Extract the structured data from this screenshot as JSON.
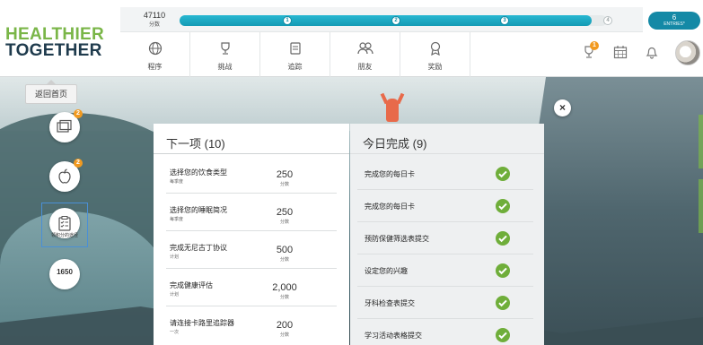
{
  "brand": {
    "line1": "HEALTHIER",
    "line2": "TOGETHER"
  },
  "progress": {
    "points_value": "47110",
    "points_label": "分数",
    "fill_fraction": 0.964,
    "milestones": [
      "1",
      "2",
      "3",
      "4"
    ],
    "entries_count": "6",
    "entries_label": "ENTRIES*"
  },
  "nav": [
    {
      "label": "程序",
      "icon": "globe-icon"
    },
    {
      "label": "挑战",
      "icon": "trophy-icon"
    },
    {
      "label": "追踪",
      "icon": "tracker-icon"
    },
    {
      "label": "朋友",
      "icon": "friends-icon"
    },
    {
      "label": "奖励",
      "icon": "reward-icon"
    }
  ],
  "header_icons": {
    "trophy_badge": "1",
    "calendar": "calendar-icon",
    "bell": "bell-icon"
  },
  "back_home": "返回首页",
  "side": {
    "cards_badge": "2",
    "food_badge": "2",
    "selected_label": "领积分的途径",
    "points": "1650"
  },
  "next_panel": {
    "title": "下一项 (10)",
    "items": [
      {
        "title": "选择您的饮食类型",
        "sub": "每季度",
        "points": "250",
        "points_label": "分数"
      },
      {
        "title": "选择您的睡眠简况",
        "sub": "每季度",
        "points": "250",
        "points_label": "分数"
      },
      {
        "title": "完成无尼古丁协议",
        "sub": "计划",
        "points": "500",
        "points_label": "分数"
      },
      {
        "title": "完成健康评估",
        "sub": "计划",
        "points": "2,000",
        "points_label": "分数"
      },
      {
        "title": "请连接卡路里追踪器",
        "sub": "一次",
        "points": "200",
        "points_label": "分数"
      }
    ]
  },
  "done_panel": {
    "title": "今日完成 (9)",
    "items": [
      {
        "title": "完成您的每日卡"
      },
      {
        "title": "完成您的每日卡"
      },
      {
        "title": "预防保健筛选表提交"
      },
      {
        "title": "设定您的兴趣"
      },
      {
        "title": "牙科检查表提交"
      },
      {
        "title": "学习活动表格提交"
      }
    ]
  },
  "close_label": "×"
}
